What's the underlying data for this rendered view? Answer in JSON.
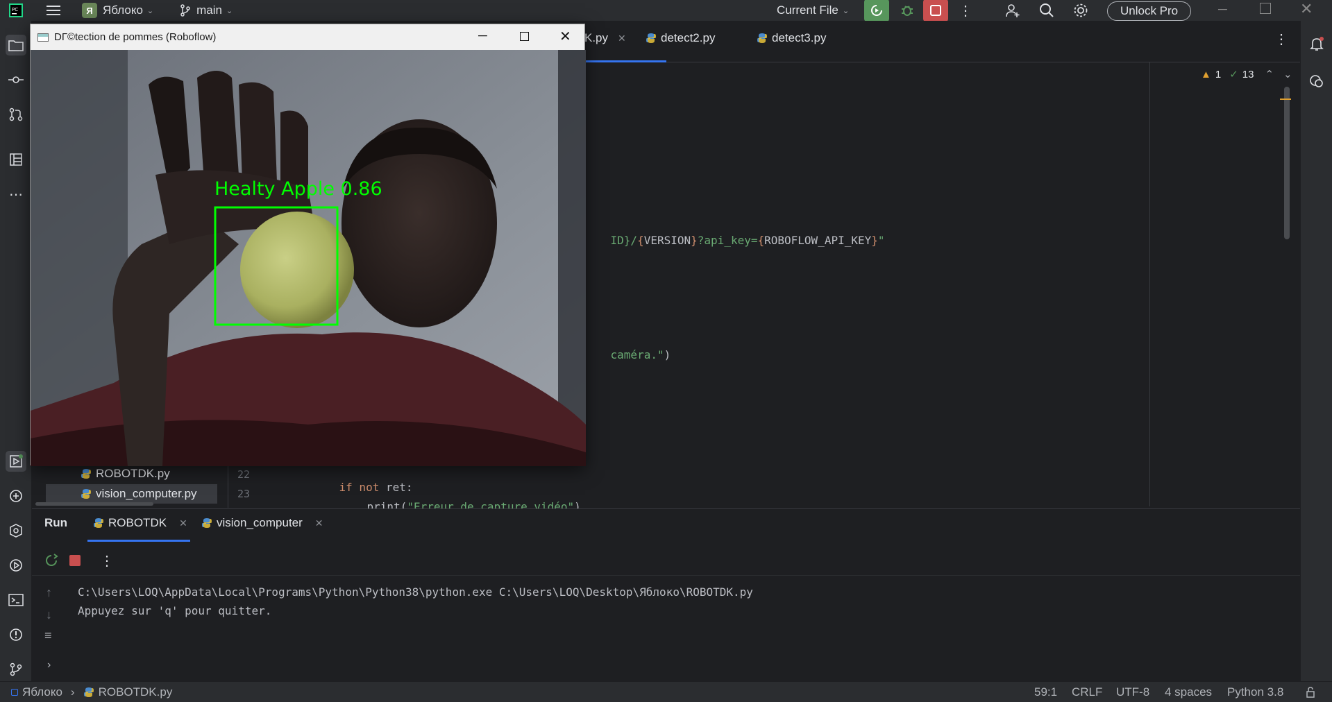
{
  "titlebar": {
    "project_badge": "Я",
    "project_name": "Яблоко",
    "branch": "main",
    "run_config": "Current File",
    "unlock_label": "Unlock Pro"
  },
  "editor": {
    "tabs": [
      {
        "label": "K.py",
        "active": true
      },
      {
        "label": "detect2.py"
      },
      {
        "label": "detect3.py"
      }
    ],
    "inspections": {
      "warnings": "1",
      "ok": "13"
    },
    "line_url": {
      "a": "ID}/",
      "b": "{",
      "c": "VERSION",
      "d": "}",
      "e": "?api_key=",
      "f": "{",
      "g": "ROBOFLOW_API_KEY",
      "h": "}",
      "i": "\""
    },
    "line_camera": {
      "a": "caméra.\"",
      "b": ")"
    },
    "lines": [
      {
        "num": "22",
        "kw": "if not",
        "rest": " ret:"
      },
      {
        "num": "23",
        "fn": "print(",
        "str_a": "\"",
        "str_under": "Erreur",
        "str_b": " de capture vidéo\"",
        "close": ")"
      }
    ]
  },
  "project_tree": {
    "items": [
      "ROBOTDK.py",
      "vision_computer.py"
    ]
  },
  "run_panel": {
    "title": "Run",
    "tabs": [
      "ROBOTDK",
      "vision_computer"
    ],
    "console": [
      "C:\\Users\\LOQ\\AppData\\Local\\Programs\\Python\\Python38\\python.exe C:\\Users\\LOQ\\Desktop\\Яблоко\\ROBOTDK.py",
      "Appuyez sur 'q' pour quitter."
    ]
  },
  "statusbar": {
    "crumb_project": "Яблоко",
    "crumb_file": "ROBOTDK.py",
    "position": "59:1",
    "line_sep": "CRLF",
    "encoding": "UTF-8",
    "indent": "4 spaces",
    "interpreter": "Python 3.8"
  },
  "camera_window": {
    "title": "DГ©tection de pommes (Roboflow)",
    "detection_label": "Healty Apple 0.86"
  },
  "colors": {
    "accent_green": "#57965c",
    "stop_red": "#c94f4f",
    "detection_green": "#00ff00"
  }
}
